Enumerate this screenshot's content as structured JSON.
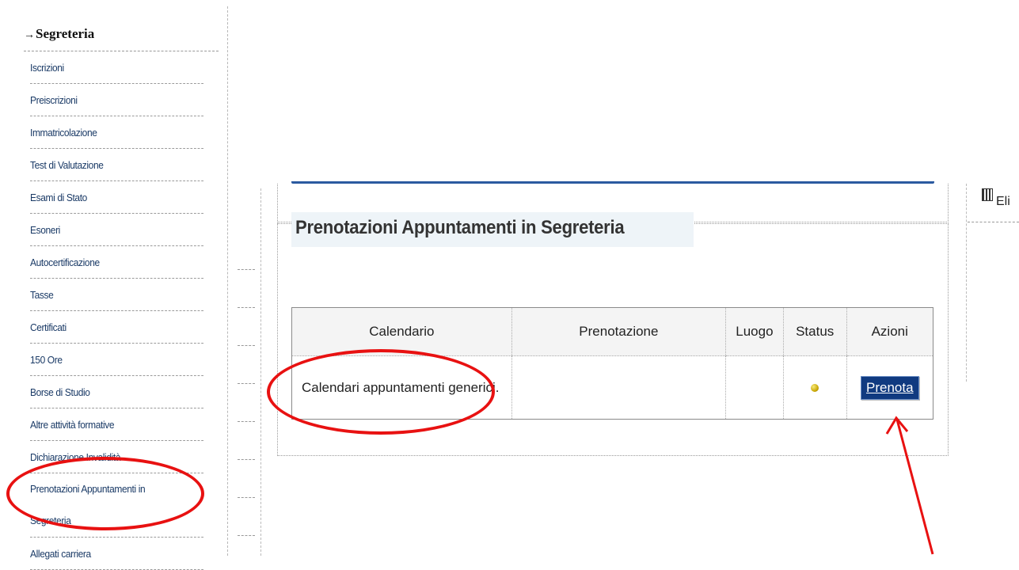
{
  "sidebar": {
    "title": "Segreteria",
    "items": [
      {
        "label": "Iscrizioni"
      },
      {
        "label": "Preiscrizioni"
      },
      {
        "label": "Immatricolazione"
      },
      {
        "label": "Test di Valutazione"
      },
      {
        "label": "Esami di Stato"
      },
      {
        "label": "Esoneri"
      },
      {
        "label": "Autocertificazione"
      },
      {
        "label": "Tasse"
      },
      {
        "label": "Certificati"
      },
      {
        "label": "150 Ore"
      },
      {
        "label": "Borse di Studio"
      },
      {
        "label": "Altre attività formative"
      },
      {
        "label": "Dichiarazione Invalidità"
      },
      {
        "label_line1": "Prenotazioni Appuntamenti in",
        "label_line2": "Segreteria"
      },
      {
        "label": "Allegati carriera"
      }
    ]
  },
  "main": {
    "section_title": "Prenotazioni Appuntamenti in Segreteria",
    "table": {
      "headers": [
        "Calendario",
        "Prenotazione",
        "Luogo",
        "Status",
        "Azioni"
      ],
      "rows": [
        {
          "calendario": "Calendari appuntamenti generici.",
          "prenotazione": "",
          "luogo": "",
          "status_icon": "yellow-dot-icon",
          "action_label": "Prenota"
        }
      ]
    }
  },
  "right_panel": {
    "text": "Eli"
  },
  "colors": {
    "annotation": "#e81111",
    "button_bg": "#103a80",
    "link": "#1a3a66"
  }
}
